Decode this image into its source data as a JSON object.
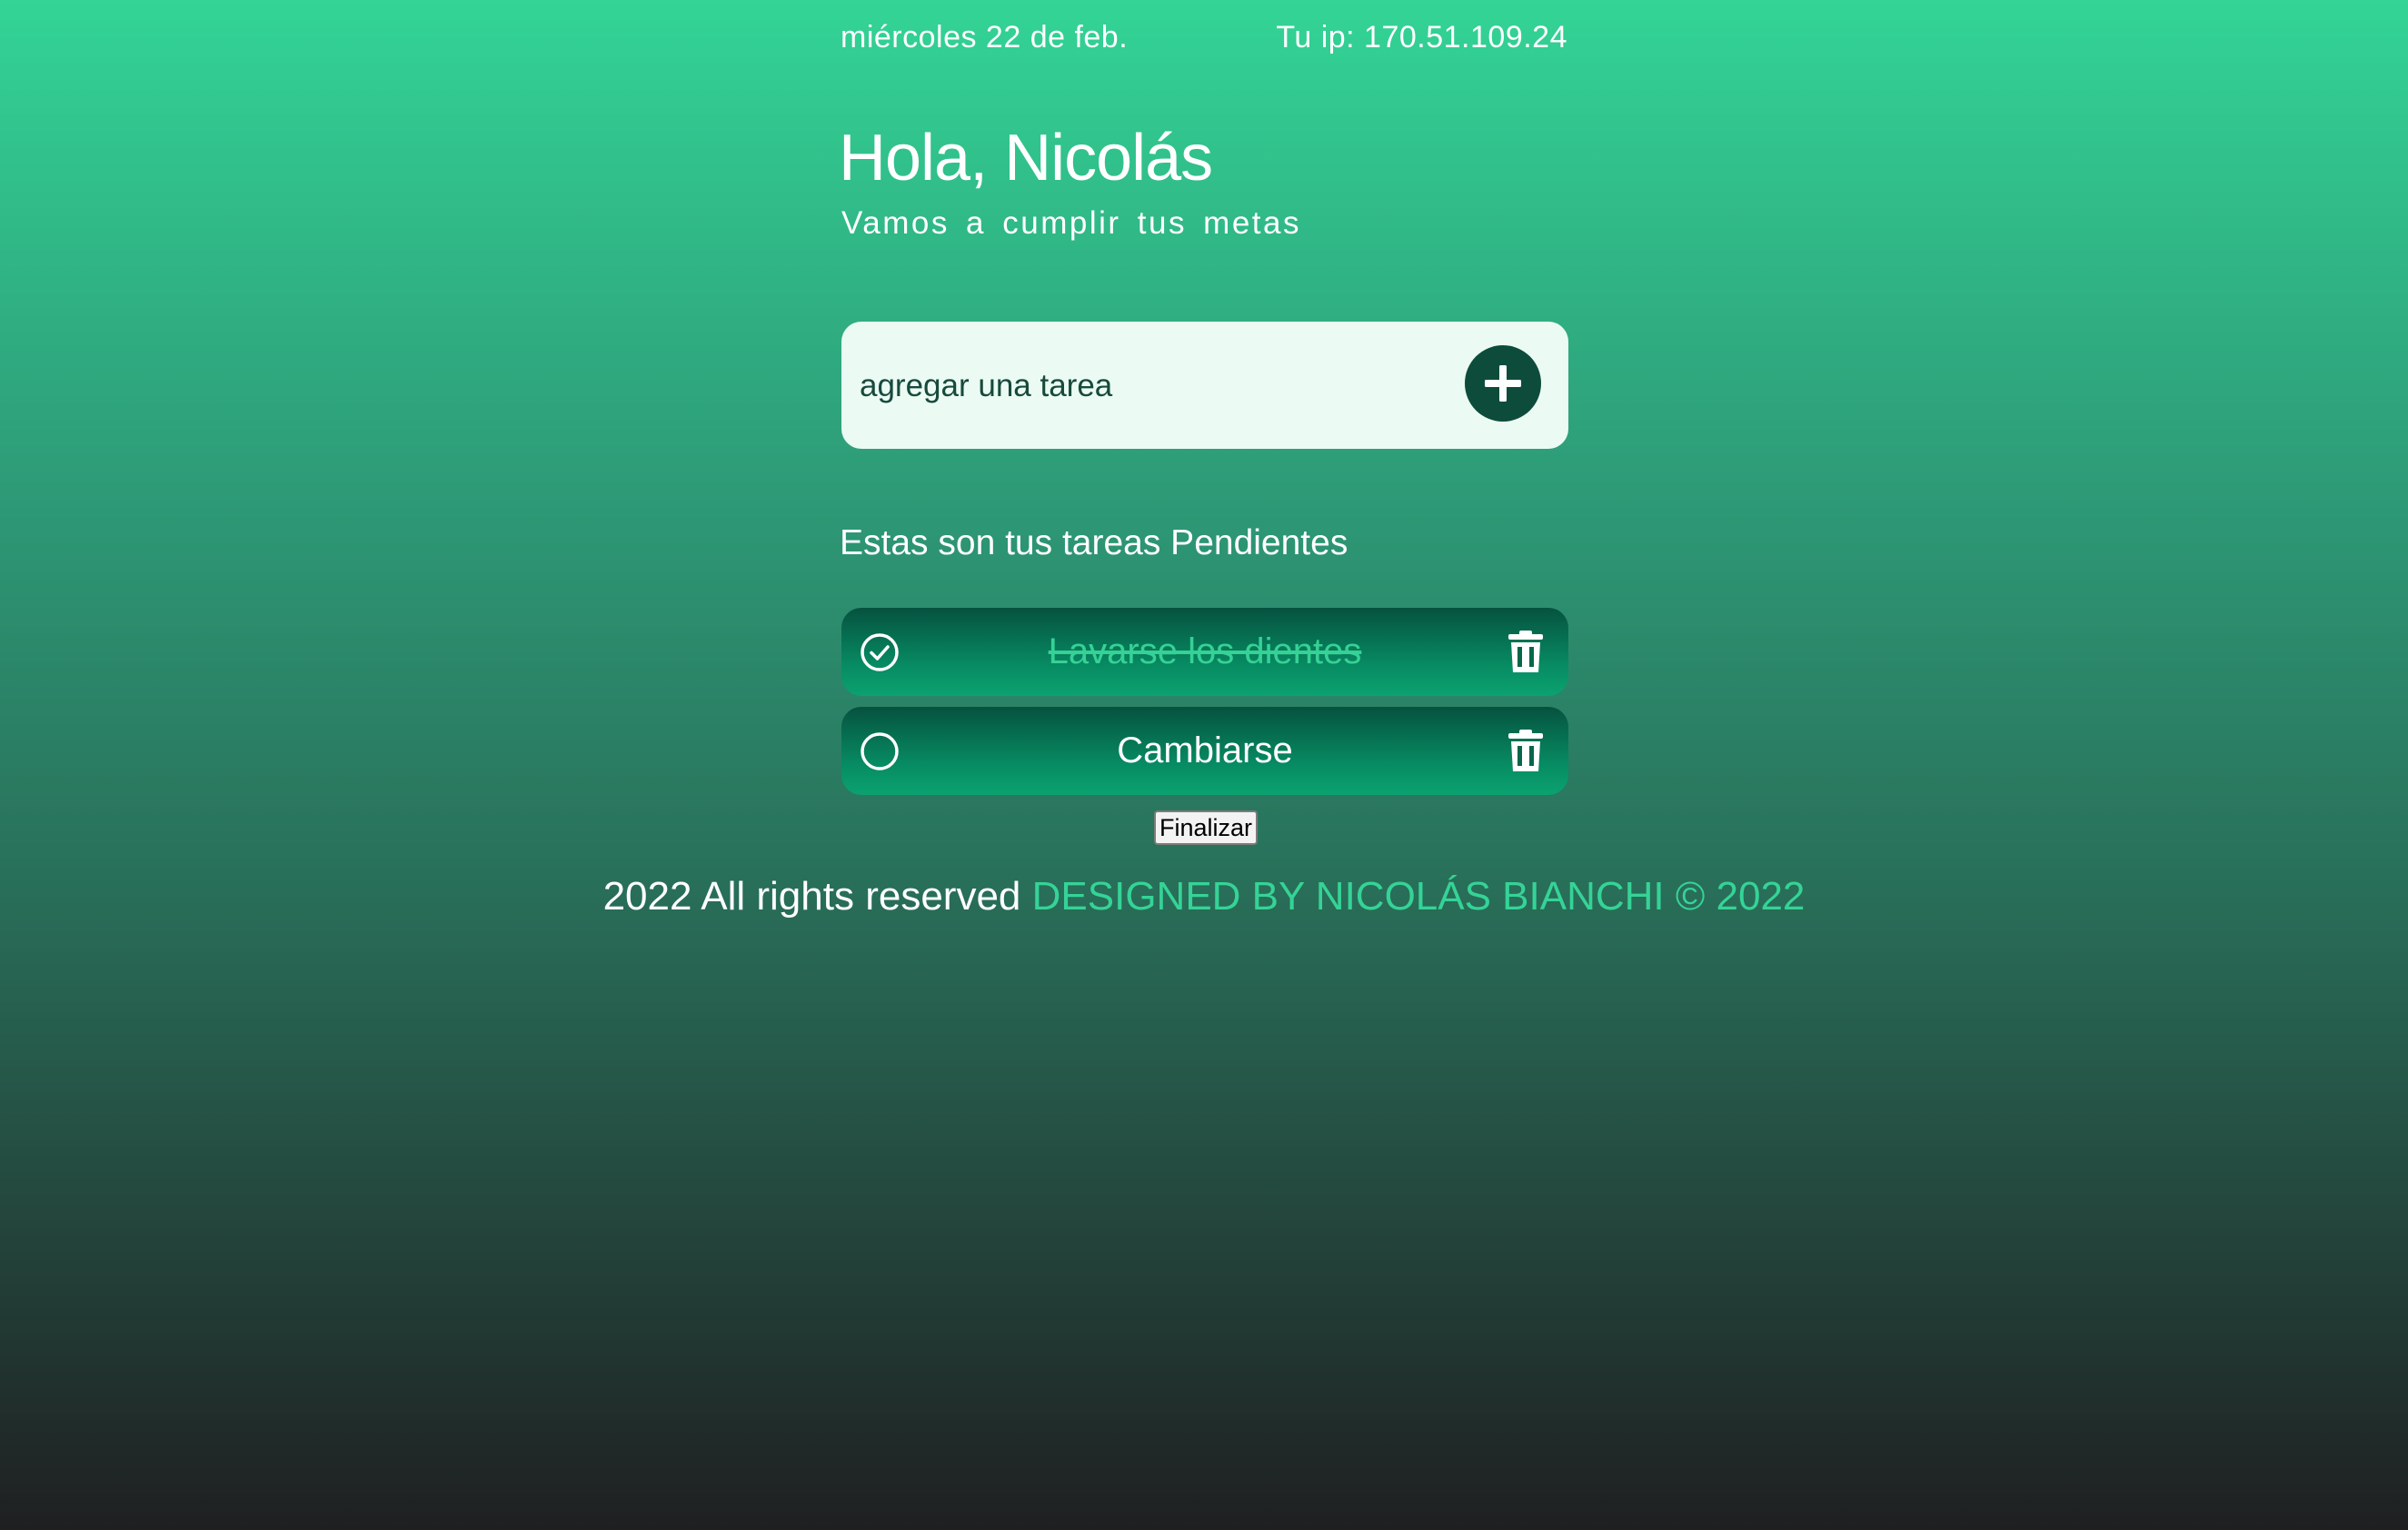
{
  "header": {
    "date": "miércoles 22 de feb.",
    "ip_text": "Tu ip: 170.51.109.24"
  },
  "greeting": {
    "title": "Hola, Nicolás",
    "subtitle": "Vamos a cumplir tus metas"
  },
  "add_task": {
    "placeholder": "agregar una tarea",
    "value": "",
    "button_icon": "plus-icon"
  },
  "tasks_section": {
    "title": "Estas son tus tareas Pendientes",
    "tasks": [
      {
        "label": "Lavarse los dientes",
        "completed": true,
        "check_icon": "check-circle-icon",
        "delete_icon": "trash-icon"
      },
      {
        "label": "Cambiarse",
        "completed": false,
        "check_icon": "empty-circle-icon",
        "delete_icon": "trash-icon"
      }
    ]
  },
  "finish_button": {
    "label": "Finalizar"
  },
  "footer": {
    "rights": "2022 All rights reserved",
    "designer": "DESIGNED BY NICOLÁS BIANCHI © 2022"
  },
  "colors": {
    "gradient_top": "#33d496",
    "gradient_bottom": "#1f1f21",
    "accent": "#35d397",
    "dark_green": "#0d4c3b",
    "input_bg": "#ebfbf3"
  }
}
